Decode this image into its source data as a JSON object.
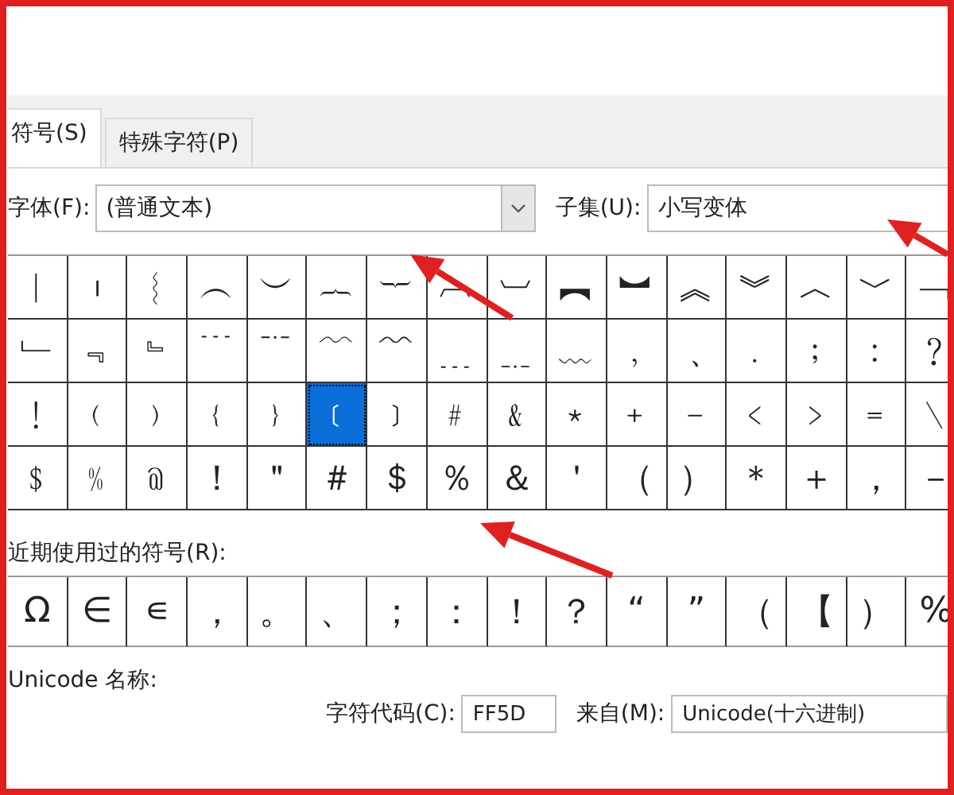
{
  "tabs": [
    {
      "label": "符号(S)",
      "selected": true
    },
    {
      "label": "特殊字符(P)",
      "selected": false
    }
  ],
  "font": {
    "label": "字体(F):",
    "value": "(普通文本)"
  },
  "subset": {
    "label": "子集(U):",
    "value": "小写变体"
  },
  "symbol_grid": [
    [
      {
        "char": "︱",
        "selected": false
      },
      {
        "char": "︲",
        "selected": false
      },
      {
        "char": "︴",
        "selected": false
      },
      {
        "char": "︵",
        "selected": false
      },
      {
        "char": "︶",
        "selected": false
      },
      {
        "char": "︷",
        "selected": false
      },
      {
        "char": "︸",
        "selected": false
      },
      {
        "char": "︹",
        "selected": false
      },
      {
        "char": "︺",
        "selected": false
      },
      {
        "char": "︻",
        "selected": false
      },
      {
        "char": "︼",
        "selected": false
      },
      {
        "char": "︽",
        "selected": false
      },
      {
        "char": "︾",
        "selected": false
      },
      {
        "char": "︿",
        "selected": false
      },
      {
        "char": "﹀",
        "selected": false
      },
      {
        "char": "﹁",
        "selected": false
      }
    ],
    [
      {
        "char": "﹂",
        "selected": false
      },
      {
        "char": "﹃",
        "selected": false
      },
      {
        "char": "﹄",
        "selected": false
      },
      {
        "char": "﹉",
        "selected": false
      },
      {
        "char": "﹊",
        "selected": false
      },
      {
        "char": "﹋",
        "selected": false
      },
      {
        "char": "﹌",
        "selected": false
      },
      {
        "char": "﹍",
        "selected": false
      },
      {
        "char": "﹎",
        "selected": false
      },
      {
        "char": "﹏",
        "selected": false
      },
      {
        "char": "﹐",
        "selected": false
      },
      {
        "char": "﹑",
        "selected": false
      },
      {
        "char": "﹒",
        "selected": false
      },
      {
        "char": "﹔",
        "selected": false
      },
      {
        "char": "﹕",
        "selected": false
      },
      {
        "char": "﹖",
        "selected": false
      }
    ],
    [
      {
        "char": "﹗",
        "selected": false
      },
      {
        "char": "﹙",
        "selected": false
      },
      {
        "char": "﹚",
        "selected": false
      },
      {
        "char": "﹛",
        "selected": false
      },
      {
        "char": "﹜",
        "selected": false
      },
      {
        "char": "﹝",
        "selected": true
      },
      {
        "char": "﹞",
        "selected": false
      },
      {
        "char": "﹟",
        "selected": false
      },
      {
        "char": "﹠",
        "selected": false
      },
      {
        "char": "﹡",
        "selected": false
      },
      {
        "char": "﹢",
        "selected": false
      },
      {
        "char": "﹣",
        "selected": false
      },
      {
        "char": "﹤",
        "selected": false
      },
      {
        "char": "﹥",
        "selected": false
      },
      {
        "char": "﹦",
        "selected": false
      },
      {
        "char": "﹨",
        "selected": false
      }
    ],
    [
      {
        "char": "﹩",
        "selected": false
      },
      {
        "char": "﹪",
        "selected": false
      },
      {
        "char": "﹫",
        "selected": false
      },
      {
        "char": "！",
        "selected": false
      },
      {
        "char": "＂",
        "selected": false
      },
      {
        "char": "＃",
        "selected": false
      },
      {
        "char": "＄",
        "selected": false
      },
      {
        "char": "％",
        "selected": false
      },
      {
        "char": "＆",
        "selected": false
      },
      {
        "char": "＇",
        "selected": false
      },
      {
        "char": "（",
        "selected": false
      },
      {
        "char": "）",
        "selected": false
      },
      {
        "char": "＊",
        "selected": false
      },
      {
        "char": "＋",
        "selected": false
      },
      {
        "char": "，",
        "selected": false
      },
      {
        "char": "－",
        "selected": false
      }
    ]
  ],
  "recent_label": "近期使用过的符号(R):",
  "recent": [
    "Ω",
    "∈",
    "∊",
    "，",
    "。",
    "、",
    "；",
    "：",
    "！",
    "？",
    "“",
    "”",
    "（",
    "【",
    "）",
    "%"
  ],
  "unicode_name_label": "Unicode 名称:",
  "char_code": {
    "label": "字符代码(C):",
    "value": "FF5D"
  },
  "from": {
    "label": "来自(M):",
    "value": "Unicode(十六进制)"
  }
}
